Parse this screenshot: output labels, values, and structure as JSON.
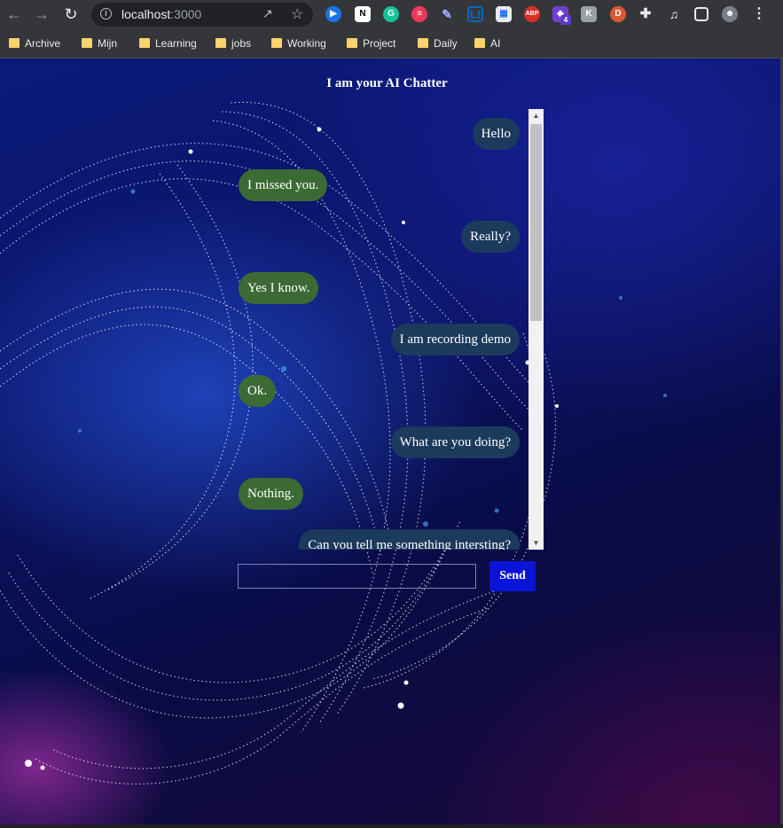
{
  "browser": {
    "url_host": "localhost",
    "url_port": ":3000",
    "extension_badge": "4",
    "bookmarks": [
      "Archive",
      "Mijn",
      "Learning",
      "jobs",
      "Working",
      "Project",
      "Daily",
      "AI"
    ]
  },
  "page": {
    "title": "I am your AI Chatter",
    "messages": [
      {
        "from": "user",
        "text": "Hello"
      },
      {
        "from": "bot",
        "text": "I missed you."
      },
      {
        "from": "user",
        "text": "Really?"
      },
      {
        "from": "bot",
        "text": "Yes I know."
      },
      {
        "from": "user",
        "text": "I am recording demo"
      },
      {
        "from": "bot",
        "text": "Ok."
      },
      {
        "from": "user",
        "text": "What are you doing?"
      },
      {
        "from": "bot",
        "text": "Nothing."
      },
      {
        "from": "user",
        "text": "Can you tell me something intersting?"
      }
    ],
    "input_value": "",
    "send_label": "Send"
  },
  "colors": {
    "user_bubble": "#1b3a5c",
    "bot_bubble": "#3c6a34",
    "send_button": "#0a14d8"
  }
}
